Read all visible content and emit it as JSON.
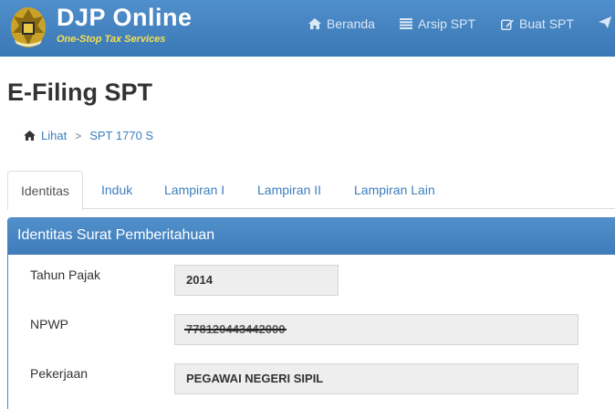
{
  "header": {
    "brand_title": "DJP Online",
    "brand_subtitle": "One-Stop Tax Services",
    "nav": [
      {
        "label": "Beranda",
        "icon": "home-icon"
      },
      {
        "label": "Arsip SPT",
        "icon": "list-icon"
      },
      {
        "label": "Buat SPT",
        "icon": "edit-icon"
      },
      {
        "label": "",
        "icon": "send-icon"
      }
    ]
  },
  "page": {
    "title": "E-Filing SPT"
  },
  "breadcrumb": {
    "items": [
      "Lihat",
      "SPT 1770 S"
    ]
  },
  "tabs": [
    {
      "label": "Identitas",
      "active": true
    },
    {
      "label": "Induk",
      "active": false
    },
    {
      "label": "Lampiran I",
      "active": false
    },
    {
      "label": "Lampiran II",
      "active": false
    },
    {
      "label": "Lampiran Lain",
      "active": false
    }
  ],
  "panel": {
    "title": "Identitas Surat Pemberitahuan",
    "fields": [
      {
        "label": "Tahun Pajak",
        "value": "2014"
      },
      {
        "label": "NPWP",
        "value": "778120443442000"
      },
      {
        "label": "Pekerjaan",
        "value": "PEGAWAI NEGERI SIPIL"
      }
    ]
  },
  "colors": {
    "header_bg": "#3b78b6",
    "subtitle": "#f4e04d",
    "link": "#3c7fc0",
    "panel_heading": "#4a86c2"
  }
}
